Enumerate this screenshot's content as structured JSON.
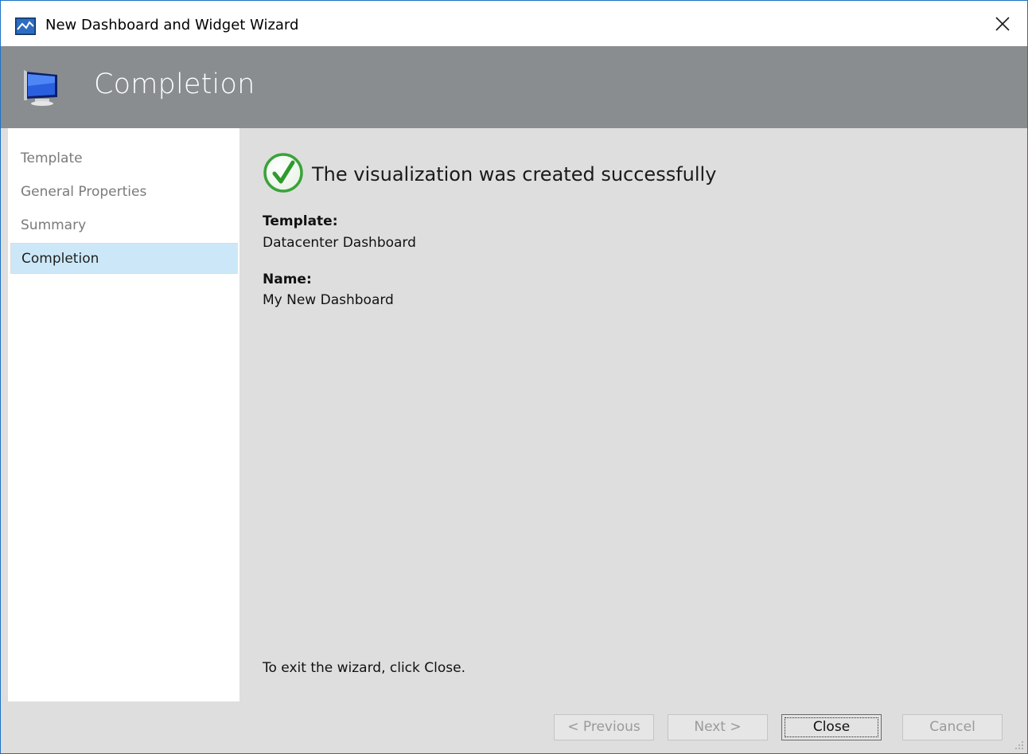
{
  "window": {
    "title": "New Dashboard and Widget Wizard",
    "icon": "wizard-chart-icon",
    "close_icon": "close-icon"
  },
  "header": {
    "title": "Completion",
    "icon": "monitor-icon"
  },
  "sidebar": {
    "steps": [
      {
        "label": "Template",
        "state": "done"
      },
      {
        "label": "General Properties",
        "state": "done"
      },
      {
        "label": "Summary",
        "state": "done"
      },
      {
        "label": "Completion",
        "state": "active"
      }
    ]
  },
  "main": {
    "success_icon": "checkmark-circle-icon",
    "success_message": "The visualization was created successfully",
    "template_label": "Template:",
    "template_value": "Datacenter Dashboard",
    "name_label": "Name:",
    "name_value": "My New Dashboard",
    "exit_hint": "To exit the wizard, click Close."
  },
  "footer": {
    "previous_label": "< Previous",
    "next_label": "Next >",
    "close_label": "Close",
    "cancel_label": "Cancel"
  },
  "colors": {
    "accent_border": "#1e72c6",
    "header_bg": "#898d90",
    "active_step_bg": "#cce8f8",
    "success_green": "#3aa33a"
  }
}
